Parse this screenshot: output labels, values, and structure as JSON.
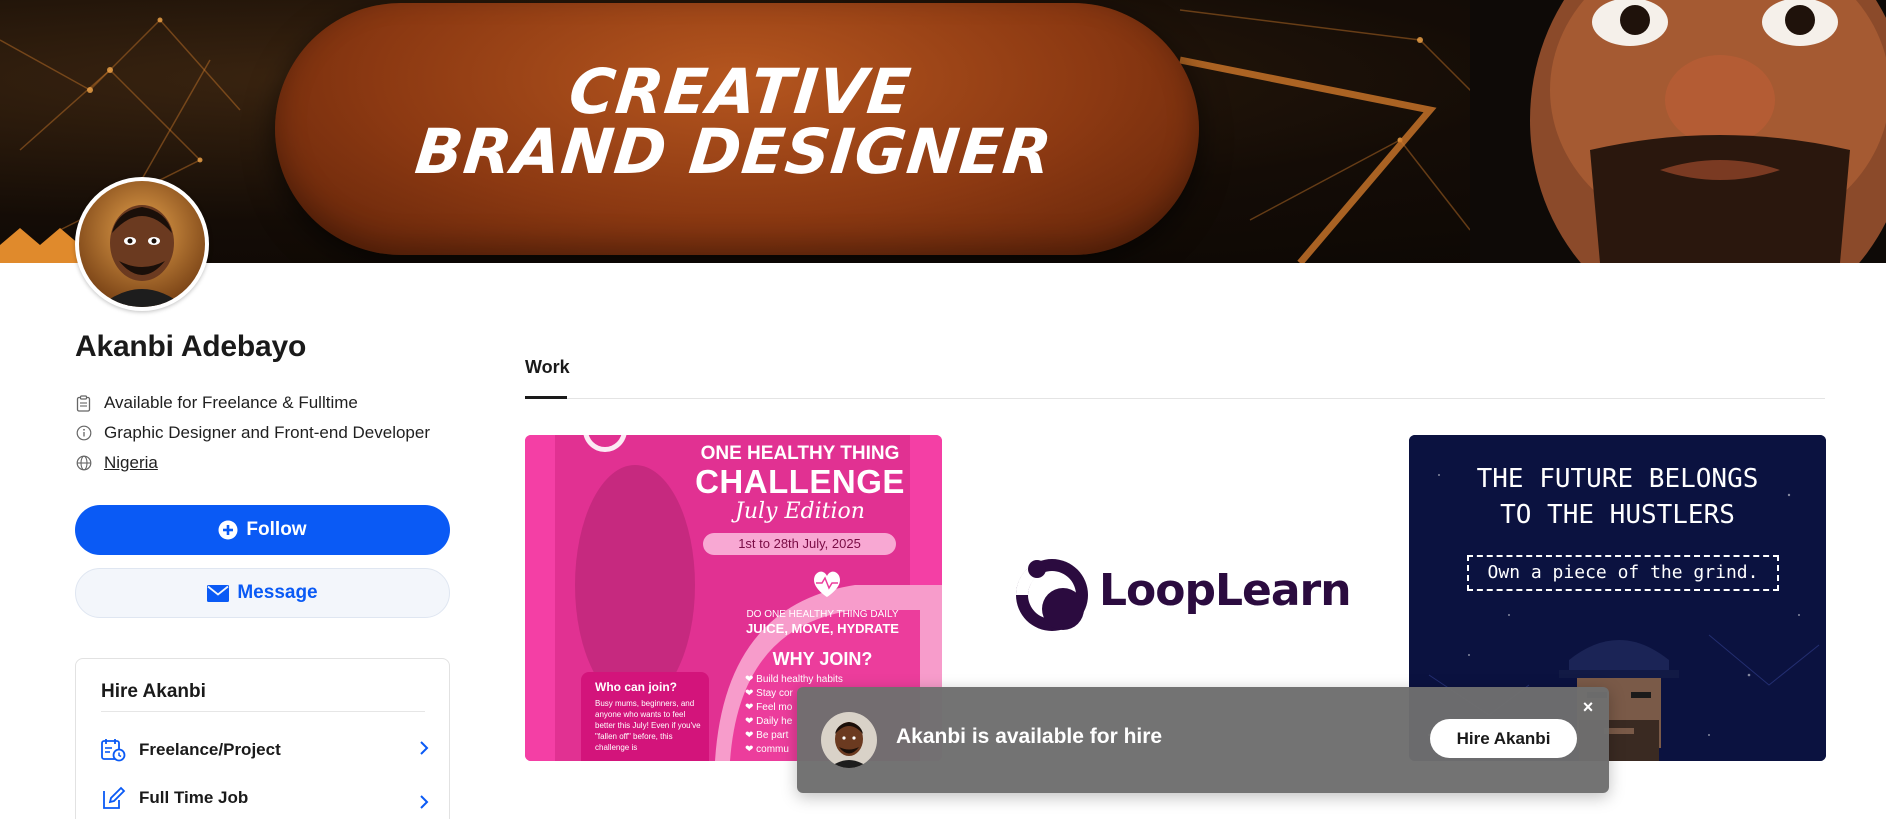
{
  "banner": {
    "line1": "CREATIVE",
    "line2": "BRAND DESIGNER"
  },
  "profile": {
    "name": "Akanbi Adebayo",
    "availability": "Available for Freelance & Fulltime",
    "role": "Graphic Designer and Front-end Developer",
    "location": "Nigeria"
  },
  "actions": {
    "follow_label": "Follow",
    "message_label": "Message"
  },
  "hire": {
    "title": "Hire Akanbi",
    "options": [
      {
        "label": "Freelance/Project"
      },
      {
        "label": "Full Time Job"
      }
    ]
  },
  "tabs": [
    {
      "label": "Work",
      "active": true
    }
  ],
  "work": {
    "card1": {
      "line1": "ONE HEALTHY THING",
      "line2": "CHALLENGE",
      "line3": "July Edition",
      "date": "1st to 28th July, 2025",
      "daily": "DO ONE HEALTHY THING DAILY",
      "slogan": "JUICE, MOVE, HYDRATE",
      "why": "WHY JOIN?",
      "bullets": [
        "❤ Build healthy habits",
        "❤ Stay cor",
        "❤ Feel mo",
        "❤ Daily he",
        "❤ Be part",
        "❤ commu"
      ],
      "box_title": "Who can join?",
      "box_body": "Busy mums, beginners, and anyone who wants to feel better this July! Even if you've \"fallen off\" before, this challenge is"
    },
    "card2": {
      "brand": "LoopLearn"
    },
    "card3": {
      "line1": "THE FUTURE BELONGS",
      "line2": "TO THE HUSTLERS",
      "tagline": "Own a piece of the grind."
    }
  },
  "toast": {
    "message": "Akanbi is available for hire",
    "button_label": "Hire Akanbi",
    "close_glyph": "×"
  },
  "colors": {
    "primary": "#0a5af5",
    "banner_pill": "#8c3912",
    "card1_pink": "#f43fa5",
    "card3_navy": "#0b1240",
    "toast_bg": "#6e6e6e"
  }
}
